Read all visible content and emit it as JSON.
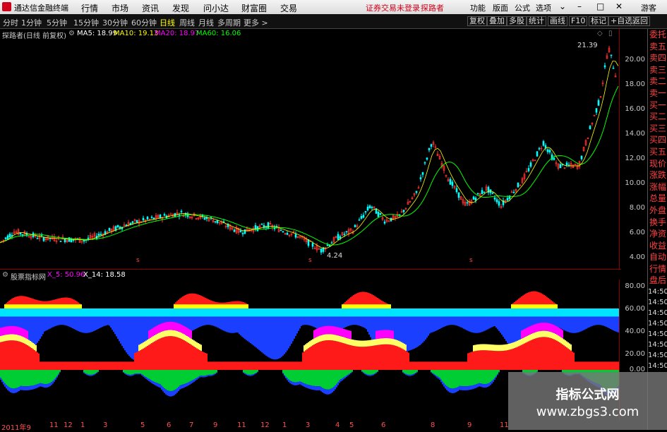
{
  "app": {
    "title": "通达信金融终端"
  },
  "menu": [
    "行情",
    "市场",
    "资讯",
    "发现",
    "问小达",
    "财富圈",
    "交易"
  ],
  "login_status": "证券交易未登录",
  "user_label": "探路者",
  "right_menu": [
    "功能",
    "版面",
    "公式",
    "选项"
  ],
  "guest": "游客",
  "periods": [
    "分时",
    "1分钟",
    "5分钟",
    "15分钟",
    "30分钟",
    "60分钟",
    "日线",
    "周线",
    "月线",
    "多周期",
    "更多 >"
  ],
  "active_period": "日线",
  "toolbar": [
    "复权",
    "叠加",
    "多股",
    "统计",
    "画线",
    "F10",
    "标记",
    "+自选",
    "返回"
  ],
  "main_chart": {
    "title": "探路者(日线 前复权)",
    "ma": [
      {
        "label": "MA5: 18.99",
        "color": "#ffffff"
      },
      {
        "label": "MA10: 19.13",
        "color": "#ffff00"
      },
      {
        "label": "MA20: 18.97",
        "color": "#ff00ff"
      },
      {
        "label": "MA60: 16.06",
        "color": "#00ff00"
      }
    ],
    "price_ticks": [
      "20.00",
      "18.00",
      "16.00",
      "14.00",
      "12.00",
      "10.00",
      "8.00",
      "6.00",
      "4.00"
    ],
    "high_label": "21.39",
    "low_label": "4.24"
  },
  "indicator": {
    "title": "股票指标网",
    "x5": "X_5: 50.96",
    "x14": "X_14: 18.58",
    "ticks": [
      "80.00",
      "60.00",
      "40.00",
      "20.00",
      "0.00"
    ]
  },
  "right_panel": [
    "委托",
    "卖五",
    "卖四",
    "卖三",
    "卖二",
    "卖一",
    "买一",
    "买二",
    "买三",
    "买四",
    "买五",
    "现价",
    "涨跌",
    "涨幅",
    "总量",
    "外盘",
    "换手",
    "净资",
    "收益",
    "自动",
    "行情",
    "盘后",
    "14:50",
    "14:50",
    "14:50",
    "14:50",
    "14:50",
    "14:50",
    "14:50",
    "14:50"
  ],
  "date_axis": [
    "2011年9",
    "11",
    "12",
    "1",
    "3",
    "5",
    "6",
    "7",
    "9",
    "11",
    "12",
    "1",
    "3",
    "4",
    "5",
    "6",
    "8",
    "9",
    "11"
  ],
  "watermark": {
    "line1": "指标公式网",
    "line2": "www.zbgs3.com"
  },
  "colors": {
    "up": "#ff3232",
    "down": "#00ffff",
    "ma60": "#00ff00",
    "ma5": "#ffffff",
    "ma10": "#ffff00",
    "ma20": "#ff00ff"
  }
}
